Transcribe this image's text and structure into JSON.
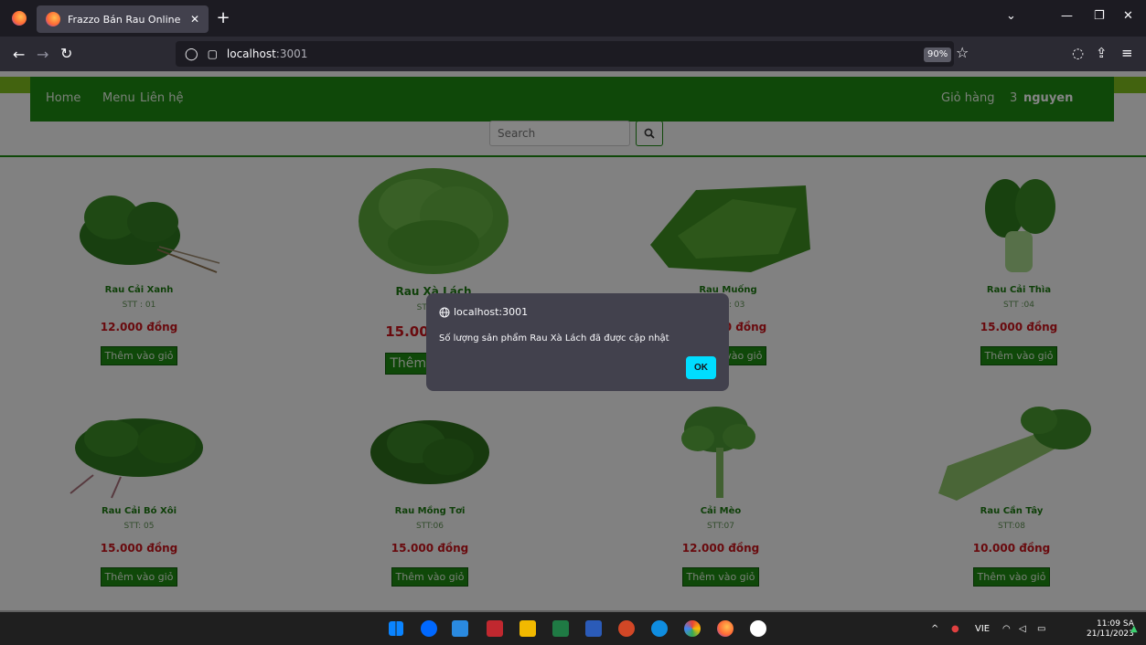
{
  "browser": {
    "tab_title": "Frazzo Bán Rau Online",
    "url_host": "localhost",
    "url_port": ":3001",
    "zoom": "90%"
  },
  "site": {
    "nav": {
      "home": "Home",
      "menu": "Menu",
      "contact": "Liên hệ",
      "cart": "Giỏ hàng",
      "cart_count": "3",
      "user": "nguyen"
    },
    "search_placeholder": "Search"
  },
  "products": [
    {
      "name": "Rau Cải Xanh",
      "stt": "STT : 01",
      "price": "12.000 đồng",
      "button": "Thêm vào giỏ"
    },
    {
      "name": "Rau Xà Lách",
      "stt": "STT : 02",
      "price": "15.000 đồng",
      "button": "Thêm vào giỏ"
    },
    {
      "name": "Rau Muống",
      "stt": "STT : 03",
      "price": "12.000 đồng",
      "button": "Thêm vào giỏ"
    },
    {
      "name": "Rau Cải Thìa",
      "stt": "STT :04",
      "price": "15.000 đồng",
      "button": "Thêm vào giỏ"
    },
    {
      "name": "Rau Cải Bó Xôi",
      "stt": "STT: 05",
      "price": "15.000 đồng",
      "button": "Thêm vào giỏ"
    },
    {
      "name": "Rau Mồng Tơi",
      "stt": "STT:06",
      "price": "15.000 đồng",
      "button": "Thêm vào giỏ"
    },
    {
      "name": "Cải Mèo",
      "stt": "STT:07",
      "price": "12.000 đồng",
      "button": "Thêm vào giỏ"
    },
    {
      "name": "Rau Cần Tây",
      "stt": "STT:08",
      "price": "10.000 đồng",
      "button": "Thêm vào giỏ"
    }
  ],
  "dialog": {
    "origin": "localhost:3001",
    "message": "Số lượng sản phẩm Rau Xà Lách đã được cập nhật",
    "ok_label": "OK"
  },
  "taskbar": {
    "language": "VIE",
    "time": "11:09 SA",
    "date": "21/11/2023"
  }
}
